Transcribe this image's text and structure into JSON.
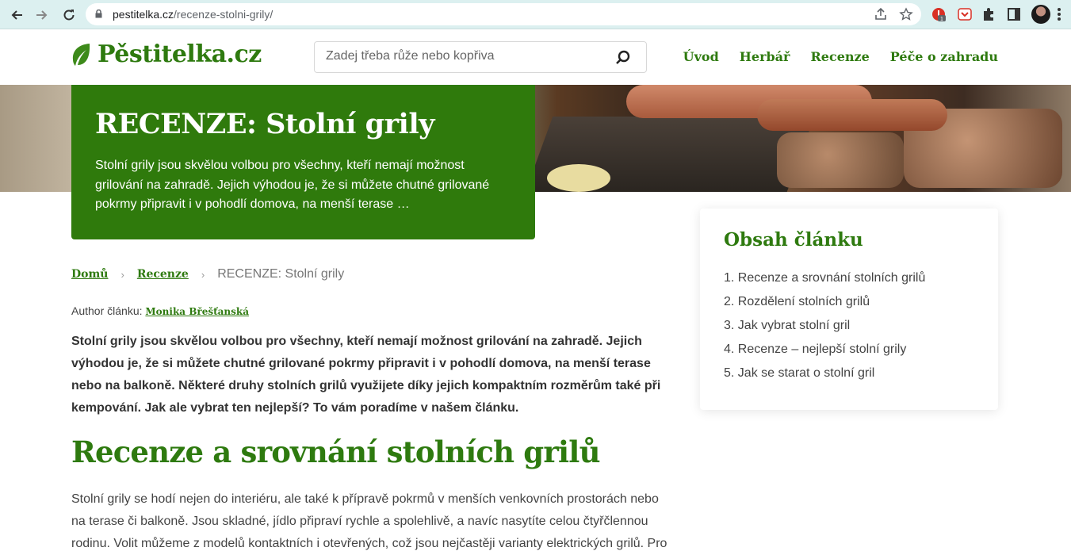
{
  "browser": {
    "url_domain": "pestitelka.cz",
    "url_path": "/recenze-stolni-grily/",
    "ext_badge": "1"
  },
  "site": {
    "logo_text": "Pěstitelka.cz",
    "search_placeholder": "Zadej třeba růže nebo kopřiva",
    "nav": [
      "Úvod",
      "Herbář",
      "Recenze",
      "Péče o zahradu"
    ]
  },
  "hero": {
    "title": "RECENZE: Stolní grily",
    "description": "Stolní grily jsou skvělou volbou pro všechny, kteří nemají možnost grilování na zahradě. Jejich výhodou je, že si můžete chutné grilované pokrmy připravit i v pohodlí domova, na menší terase …"
  },
  "breadcrumb": {
    "home": "Domů",
    "section": "Recenze",
    "current": "RECENZE: Stolní grily",
    "separator": "›"
  },
  "author": {
    "label": "Author článku:",
    "name": "Monika Břešťanská"
  },
  "article": {
    "lead": "Stolní grily jsou skvělou volbou pro všechny, kteří nemají možnost grilování na zahradě. Jejich výhodou je, že si můžete chutné grilované pokrmy připravit i v pohodlí domova, na menší terase nebo na balkoně. Některé druhy stolních grilů využijete díky jejich kompaktním rozměrům také při kempování. Jak ale vybrat ten nejlepší? To vám poradíme v našem článku.",
    "h2": "Recenze a srovnání stolních grilů",
    "body": "Stolní grily se hodí nejen do interiéru, ale také k přípravě pokrmů v menších venkovních prostorách nebo na terase či balkoně. Jsou skladné, jídlo připraví rychle a spolehlivě, a navíc nasytíte celou čtyřčlennou rodinu. Volit můžeme z modelů kontaktních i otevřených, což jsou nejčastěji varianty elektrických grilů. Pro"
  },
  "toc": {
    "title": "Obsah článku",
    "items": [
      "1. Recenze a srovnání stolních grilů",
      "2. Rozdělení stolních grilů",
      "3. Jak vybrat stolní gril",
      "4. Recenze – nejlepší stolní grily",
      "5. Jak se starat o stolní gril"
    ]
  },
  "colors": {
    "brand_green": "#2e7a0c",
    "chrome_bg": "#dcf0f0"
  }
}
